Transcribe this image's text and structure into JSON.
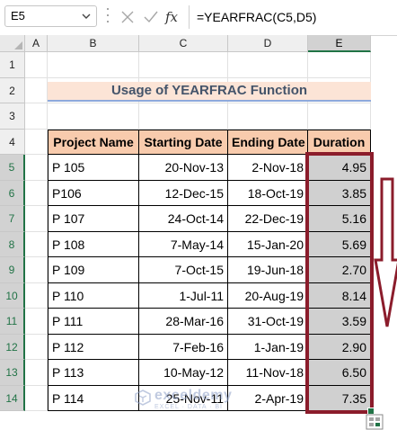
{
  "formula_bar": {
    "name_box": "E5",
    "fx_label": "fx",
    "formula": "=YEARFRAC(C5,D5)"
  },
  "columns": [
    "A",
    "B",
    "C",
    "D",
    "E"
  ],
  "rows": [
    "1",
    "2",
    "3",
    "4",
    "5",
    "6",
    "7",
    "8",
    "9",
    "10",
    "11",
    "12",
    "13",
    "14"
  ],
  "title": "Usage of YEARFRAC Function",
  "table": {
    "headers": [
      "Project Name",
      "Starting Date",
      "Ending Date",
      "Duration"
    ],
    "rows": [
      [
        "P 105",
        "20-Nov-13",
        "2-Nov-18",
        "4.95"
      ],
      [
        "P106",
        "12-Dec-15",
        "18-Oct-19",
        "3.85"
      ],
      [
        "P 107",
        "24-Oct-14",
        "22-Dec-19",
        "5.16"
      ],
      [
        "P 108",
        "7-May-14",
        "15-Jan-20",
        "5.69"
      ],
      [
        "P 109",
        "7-Oct-15",
        "19-Jun-18",
        "2.70"
      ],
      [
        "P 110",
        "1-Jul-11",
        "20-Aug-19",
        "8.14"
      ],
      [
        "P 111",
        "28-Mar-16",
        "31-Oct-19",
        "3.59"
      ],
      [
        "P 112",
        "7-Feb-16",
        "1-Jan-19",
        "2.90"
      ],
      [
        "P 113",
        "10-May-12",
        "11-Nov-18",
        "6.50"
      ],
      [
        "P 114",
        "25-Nov-11",
        "2-Apr-19",
        "7.35"
      ]
    ]
  },
  "watermark": {
    "name": "exceldemy",
    "tagline": "EXCEL · DATA · BI"
  },
  "colors": {
    "title_fill": "#fce4d6",
    "header_fill": "#f8cbad",
    "selection_box": "#8b1c2b",
    "selected_fill": "#d0d0d0",
    "excel_green": "#217346"
  }
}
